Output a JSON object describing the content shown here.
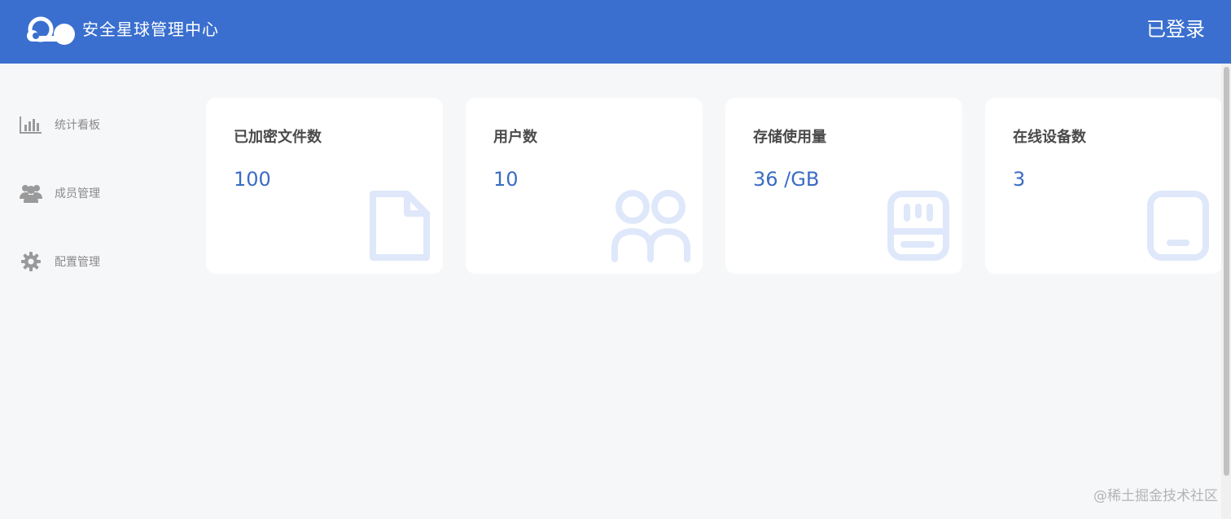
{
  "header": {
    "brand_title": "安全星球管理中心",
    "login_status": "已登录",
    "logo_icon": "cloud-logo-icon"
  },
  "sidebar": {
    "items": [
      {
        "label": "统计看板",
        "icon": "bar-chart-icon"
      },
      {
        "label": "成员管理",
        "icon": "users-icon"
      },
      {
        "label": "配置管理",
        "icon": "gear-icon"
      }
    ]
  },
  "cards": [
    {
      "title": "已加密文件数",
      "value": "100",
      "icon": "file-icon"
    },
    {
      "title": "用户数",
      "value": "10",
      "icon": "users-outline-icon"
    },
    {
      "title": "存储使用量",
      "value": "36 /GB",
      "icon": "storage-icon"
    },
    {
      "title": "在线设备数",
      "value": "3",
      "icon": "tablet-icon"
    }
  ],
  "watermark": "@稀土掘金技术社区",
  "colors": {
    "header_bg": "#3a6fcf",
    "page_bg": "#f6f7f9",
    "value_text": "#3a6cc4",
    "card_icon": "#dfe8fa"
  }
}
